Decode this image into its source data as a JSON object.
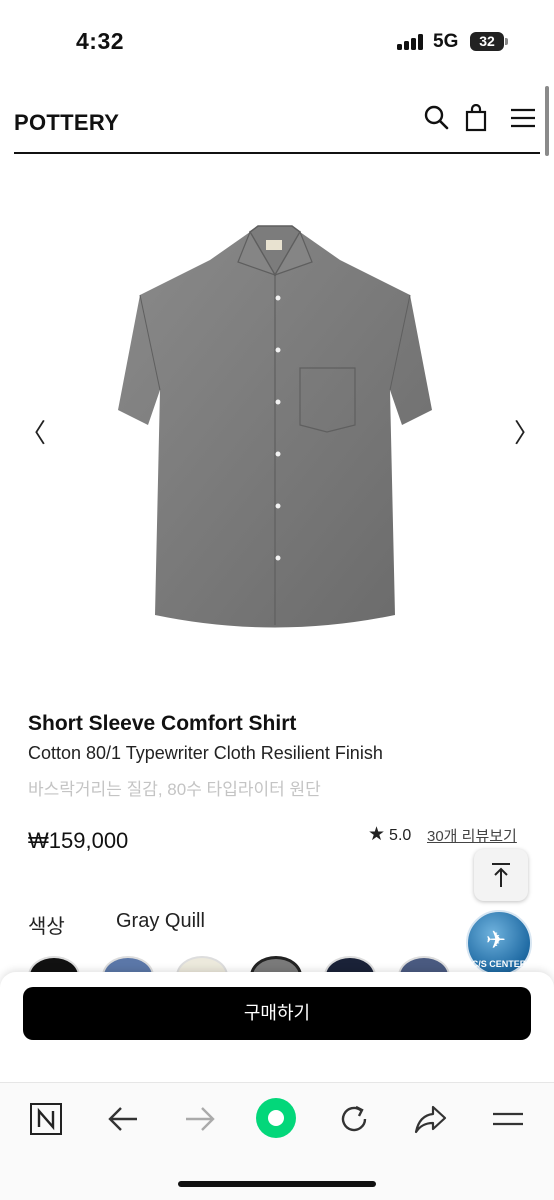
{
  "status_bar": {
    "time": "4:32",
    "network": "5G",
    "battery": "32"
  },
  "header": {
    "brand": "POTTERY",
    "icons": [
      "search-icon",
      "shopping-bag-icon",
      "menu-icon"
    ]
  },
  "gallery": {
    "prev_arrow": "〈",
    "next_arrow": "〉",
    "image": "gray-short-sleeve-shirt"
  },
  "product": {
    "title": "Short Sleeve Comfort Shirt",
    "subtitle": "Cotton 80/1 Typewriter Cloth Resilient Finish",
    "description_ko": "바스락거리는 질감, 80수 타입라이터 원단",
    "price": "₩159,000",
    "rating": "5.0",
    "review_link": "30개 리뷰보기"
  },
  "options": {
    "color_label": "색상",
    "color_value": "Gray Quill",
    "swatches": [
      {
        "color": "#111111",
        "selected": false
      },
      {
        "color": "#5b77a8",
        "selected": false
      },
      {
        "color": "#ece9dc",
        "selected": false
      },
      {
        "color": "#7a7a7a",
        "selected": true
      },
      {
        "color": "#1a2238",
        "selected": false
      },
      {
        "color": "#4a5a80",
        "selected": false
      }
    ]
  },
  "floating": {
    "top_button": "arrow-up-icon",
    "cs_badge": "C/S CENTER"
  },
  "purchase": {
    "buy_label": "구매하기"
  },
  "browser_bar": {
    "items": [
      "naver-icon",
      "back-icon",
      "forward-icon",
      "green-dot-icon",
      "reload-icon",
      "share-icon",
      "menu-icon"
    ]
  }
}
